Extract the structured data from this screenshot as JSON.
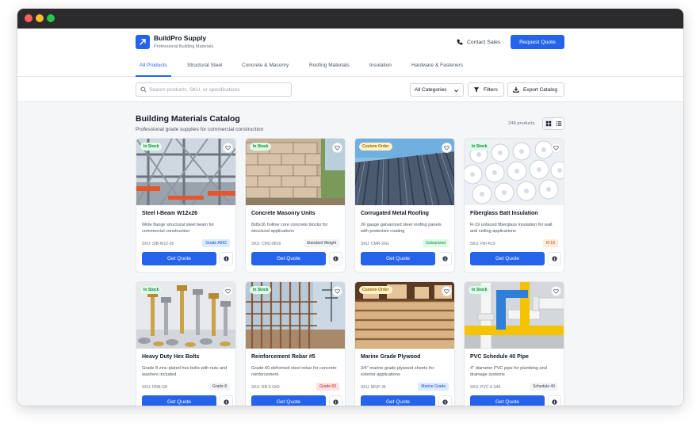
{
  "brand": {
    "name": "BuildPro Supply",
    "tagline": "Professional Building Materials"
  },
  "header": {
    "contact_label": "Contact Sales",
    "request_quote_label": "Request Quote"
  },
  "tabs": [
    "All Products",
    "Structural Steel",
    "Concrete & Masonry",
    "Roofing Materials",
    "Insulation",
    "Hardware & Fasteners"
  ],
  "active_tab": "All Products",
  "toolbar": {
    "search_placeholder": "Search products, SKU, or specifications",
    "category_value": "All Categories",
    "filters_label": "Filters",
    "export_label": "Export Catalog"
  },
  "catalog": {
    "title": "Building Materials Catalog",
    "subtitle": "Professional grade supplies for commercial construction",
    "count": "248 products",
    "view_mode": "grid"
  },
  "colors": {
    "accent": "#2563eb",
    "in_stock": "#15803d",
    "custom_order": "#a16207"
  },
  "products": [
    {
      "status": "In Stock",
      "status_kind": "in",
      "name": "Steel I-Beam W12x26",
      "desc": "Wide flange structural steel beam for commercial construction",
      "sku": "SKU: SIB-W12-26",
      "tag": "Grade A992",
      "tag_kind": "blue",
      "cta": "Get Quote",
      "image": "steel-beams"
    },
    {
      "status": "In Stock",
      "status_kind": "in",
      "name": "Concrete Masonry Units",
      "desc": "8x8x16 hollow core concrete blocks for structural applications",
      "sku": "SKU: CMU-8816",
      "tag": "Standard Weight",
      "tag_kind": "gray",
      "cta": "Get Quote",
      "image": "concrete-blocks"
    },
    {
      "status": "Custom Order",
      "status_kind": "custom",
      "name": "Corrugated Metal Roofing",
      "desc": "26 gauge galvanized steel roofing panels with protective coating",
      "sku": "SKU: CMR-26G",
      "tag": "Galvanized",
      "tag_kind": "green",
      "cta": "Get Quote",
      "image": "metal-roofing"
    },
    {
      "status": "In Stock",
      "status_kind": "in",
      "name": "Fiberglass Batt Insulation",
      "desc": "R-19 unfaced fiberglass insulation for wall and ceiling applications",
      "sku": "SKU: FBI-R19",
      "tag": "R-19",
      "tag_kind": "orange",
      "cta": "Get Quote",
      "image": "insulation-rolls"
    },
    {
      "status": "In Stock",
      "status_kind": "in",
      "name": "Heavy Duty Hex Bolts",
      "desc": "Grade 8 zinc-plated hex bolts with nuts and washers included",
      "sku": "SKU: HDB-G8",
      "tag": "Grade 8",
      "tag_kind": "gray",
      "cta": "Get Quote",
      "image": "hex-bolts"
    },
    {
      "status": "In Stock",
      "status_kind": "in",
      "name": "Reinforcement Rebar #5",
      "desc": "Grade 60 deformed steel rebar for concrete reinforcement",
      "sku": "SKU: RB-5-G60",
      "tag": "Grade 60",
      "tag_kind": "red",
      "cta": "Get Quote",
      "image": "rebar"
    },
    {
      "status": "Custom Order",
      "status_kind": "custom",
      "name": "Marine Grade Plywood",
      "desc": "3/4\" marine grade plywood sheets for exterior applications",
      "sku": "SKU: MGP-34",
      "tag": "Marine Grade",
      "tag_kind": "blue",
      "cta": "Get Quote",
      "image": "plywood"
    },
    {
      "status": "In Stock",
      "status_kind": "in",
      "name": "PVC Schedule 40 Pipe",
      "desc": "4\" diameter PVC pipe for plumbing and drainage systems",
      "sku": "SKU: PVC-4-S40",
      "tag": "Schedule 40",
      "tag_kind": "gray",
      "cta": "Get Quote",
      "image": "pvc-pipes"
    }
  ]
}
